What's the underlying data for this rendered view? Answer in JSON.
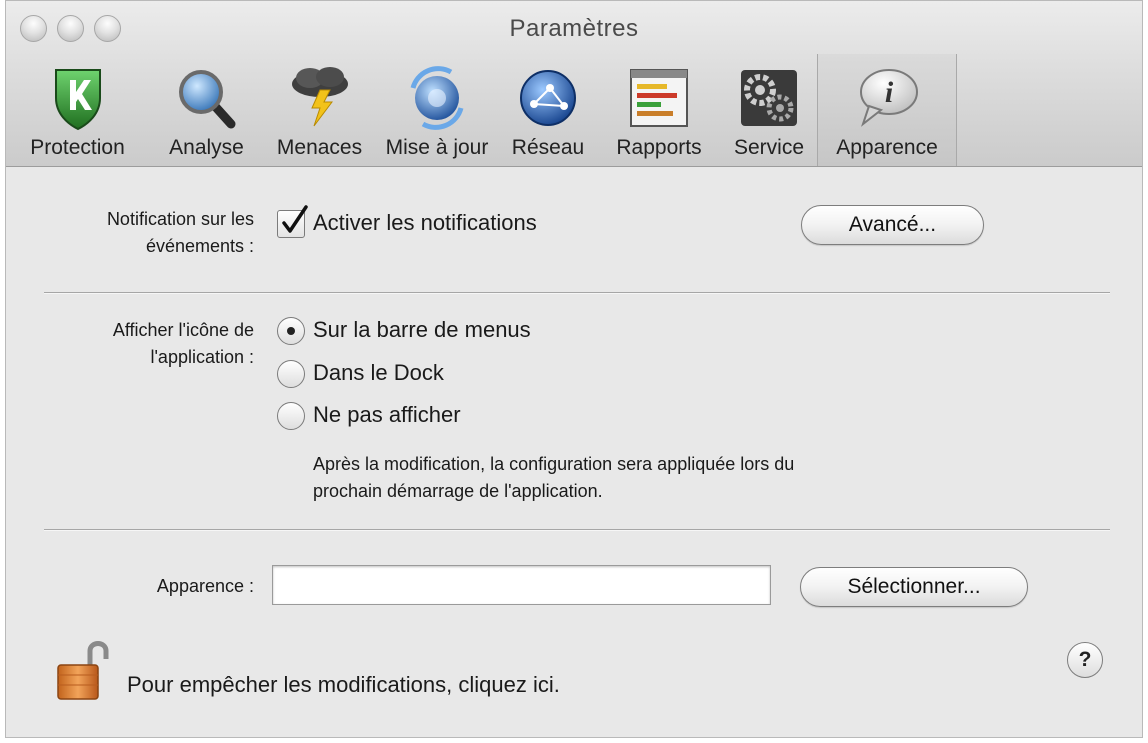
{
  "window": {
    "title": "Paramètres"
  },
  "toolbar": {
    "items": [
      {
        "label": "Protection",
        "icon": "kaspersky-shield-icon"
      },
      {
        "label": "Analyse",
        "icon": "magnifier-icon"
      },
      {
        "label": "Menaces",
        "icon": "storm-cloud-icon"
      },
      {
        "label": "Mise à jour",
        "icon": "update-globe-icon"
      },
      {
        "label": "Réseau",
        "icon": "network-globe-icon"
      },
      {
        "label": "Rapports",
        "icon": "report-sheet-icon"
      },
      {
        "label": "Service",
        "icon": "gears-icon"
      },
      {
        "label": "Apparence",
        "icon": "info-bubble-icon"
      }
    ],
    "selected": "Apparence"
  },
  "notifications": {
    "label_line1": "Notification sur les",
    "label_line2": "événements :",
    "checkbox_label": "Activer les notifications",
    "checked": true,
    "advanced_button": "Avancé..."
  },
  "app_icon": {
    "label_line1": "Afficher l'icône de",
    "label_line2": "l'application :",
    "options": [
      {
        "label": "Sur la barre de menus",
        "selected": true
      },
      {
        "label": "Dans le Dock",
        "selected": false
      },
      {
        "label": "Ne pas afficher",
        "selected": false
      }
    ],
    "note_line1": "Après la modification, la configuration sera appliquée lors du",
    "note_line2": "prochain démarrage de l'application."
  },
  "appearance": {
    "label": "Apparence :",
    "value": "",
    "select_button": "Sélectionner..."
  },
  "footer": {
    "lock_text": "Pour empêcher les modifications, cliquez ici.",
    "lock_icon": "padlock-open-icon",
    "help_label": "?"
  }
}
